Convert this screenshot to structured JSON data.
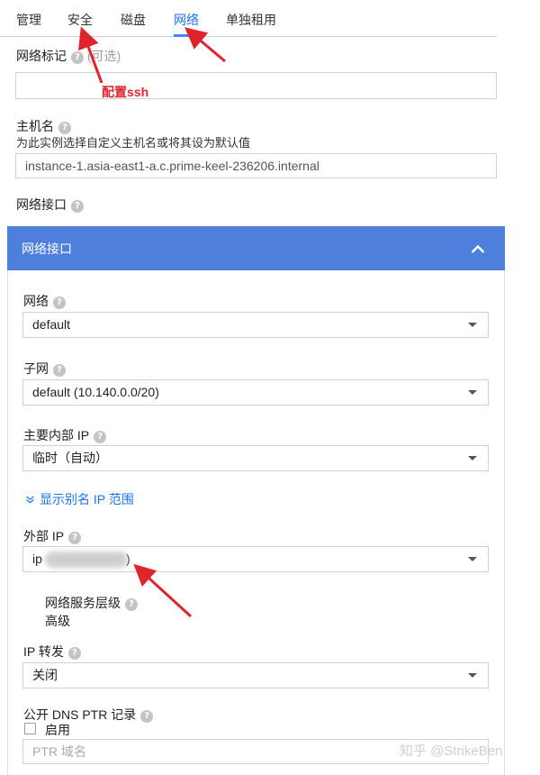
{
  "tabs": [
    {
      "label": "管理"
    },
    {
      "label": "安全"
    },
    {
      "label": "磁盘"
    },
    {
      "label": "网络"
    },
    {
      "label": "单独租用"
    }
  ],
  "network_tags": {
    "label": "网络标记",
    "optional": "(可选)",
    "value": ""
  },
  "annotation": "配置ssh",
  "hostname": {
    "label": "主机名",
    "description": "为此实例选择自定义主机名或将其设为默认值",
    "value": "instance-1.asia-east1-a.c.prime-keel-236206.internal"
  },
  "network_interfaces_label": "网络接口",
  "panel": {
    "title": "网络接口",
    "network": {
      "label": "网络",
      "value": "default"
    },
    "subnet": {
      "label": "子网",
      "value": "default (10.140.0.0/20)"
    },
    "internal_ip": {
      "label": "主要内部 IP",
      "value": "临时（自动）"
    },
    "alias_link": "显示别名 IP 范围",
    "external_ip": {
      "label": "外部 IP",
      "value_prefix": "ip",
      "value_suffix": ")"
    },
    "tier": {
      "label": "网络服务层级",
      "value": "高级"
    },
    "ip_forwarding": {
      "label": "IP 转发",
      "value": "关闭"
    },
    "dns_ptr": {
      "label": "公开 DNS PTR 记录",
      "checkbox_label": "启用",
      "placeholder": "PTR 域名"
    }
  },
  "watermark": "知乎 @StrikeBen",
  "colors": {
    "accent": "#4285f4",
    "panel_header": "#4f7fdc",
    "annotation_red": "#e0242b"
  }
}
